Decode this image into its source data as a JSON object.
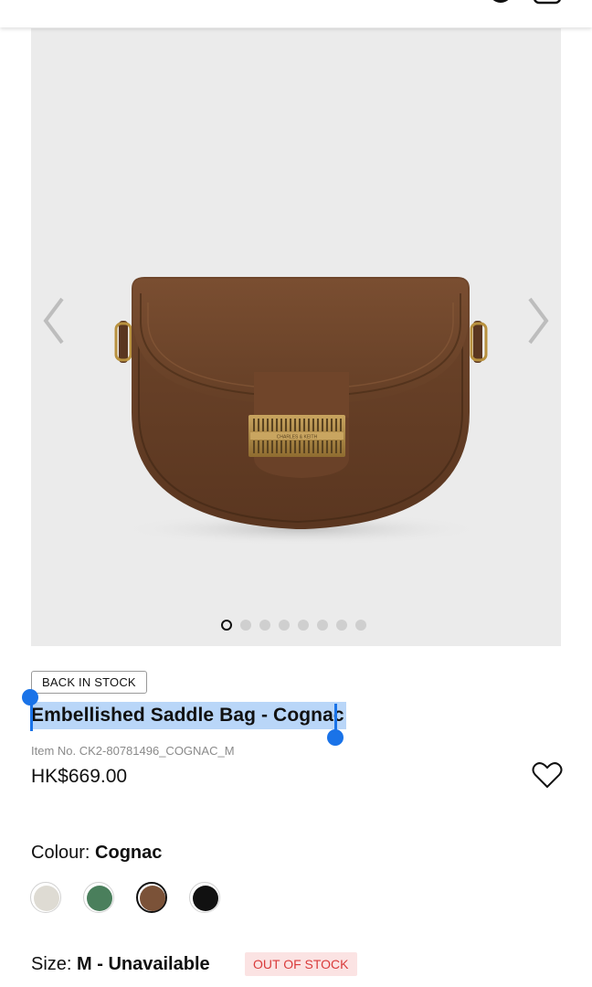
{
  "product": {
    "badge": "BACK IN STOCK",
    "title": "Embellished Saddle Bag - Cognac",
    "item_no": "Item No. CK2-80781496_COGNAC_M",
    "price": "HK$669.00",
    "image_brand_text": "CHARLES & KEITH"
  },
  "gallery": {
    "dot_count": 8,
    "active_index": 0
  },
  "colour": {
    "label": "Colour: ",
    "selected": "Cognac",
    "swatches": [
      {
        "name": "Cream",
        "hex": "#dedbd3"
      },
      {
        "name": "Green",
        "hex": "#4a7f5c"
      },
      {
        "name": "Cognac",
        "hex": "#7b5238",
        "selected": true
      },
      {
        "name": "Black",
        "hex": "#111111"
      }
    ]
  },
  "size": {
    "label": "Size: ",
    "selected": "M - Unavailable",
    "status": "OUT OF STOCK"
  },
  "icons": {
    "prev": "chevron-left-icon",
    "next": "chevron-right-icon",
    "wishlist": "heart-icon",
    "account": "account-icon",
    "bag": "shopping-bag-icon"
  },
  "colors": {
    "selection": "#b9d6f8",
    "selection_handle": "#1a73e8",
    "oos_text": "#d93b3b",
    "oos_bg": "#fbe3e3",
    "gallery_bg": "#ebebeb"
  }
}
